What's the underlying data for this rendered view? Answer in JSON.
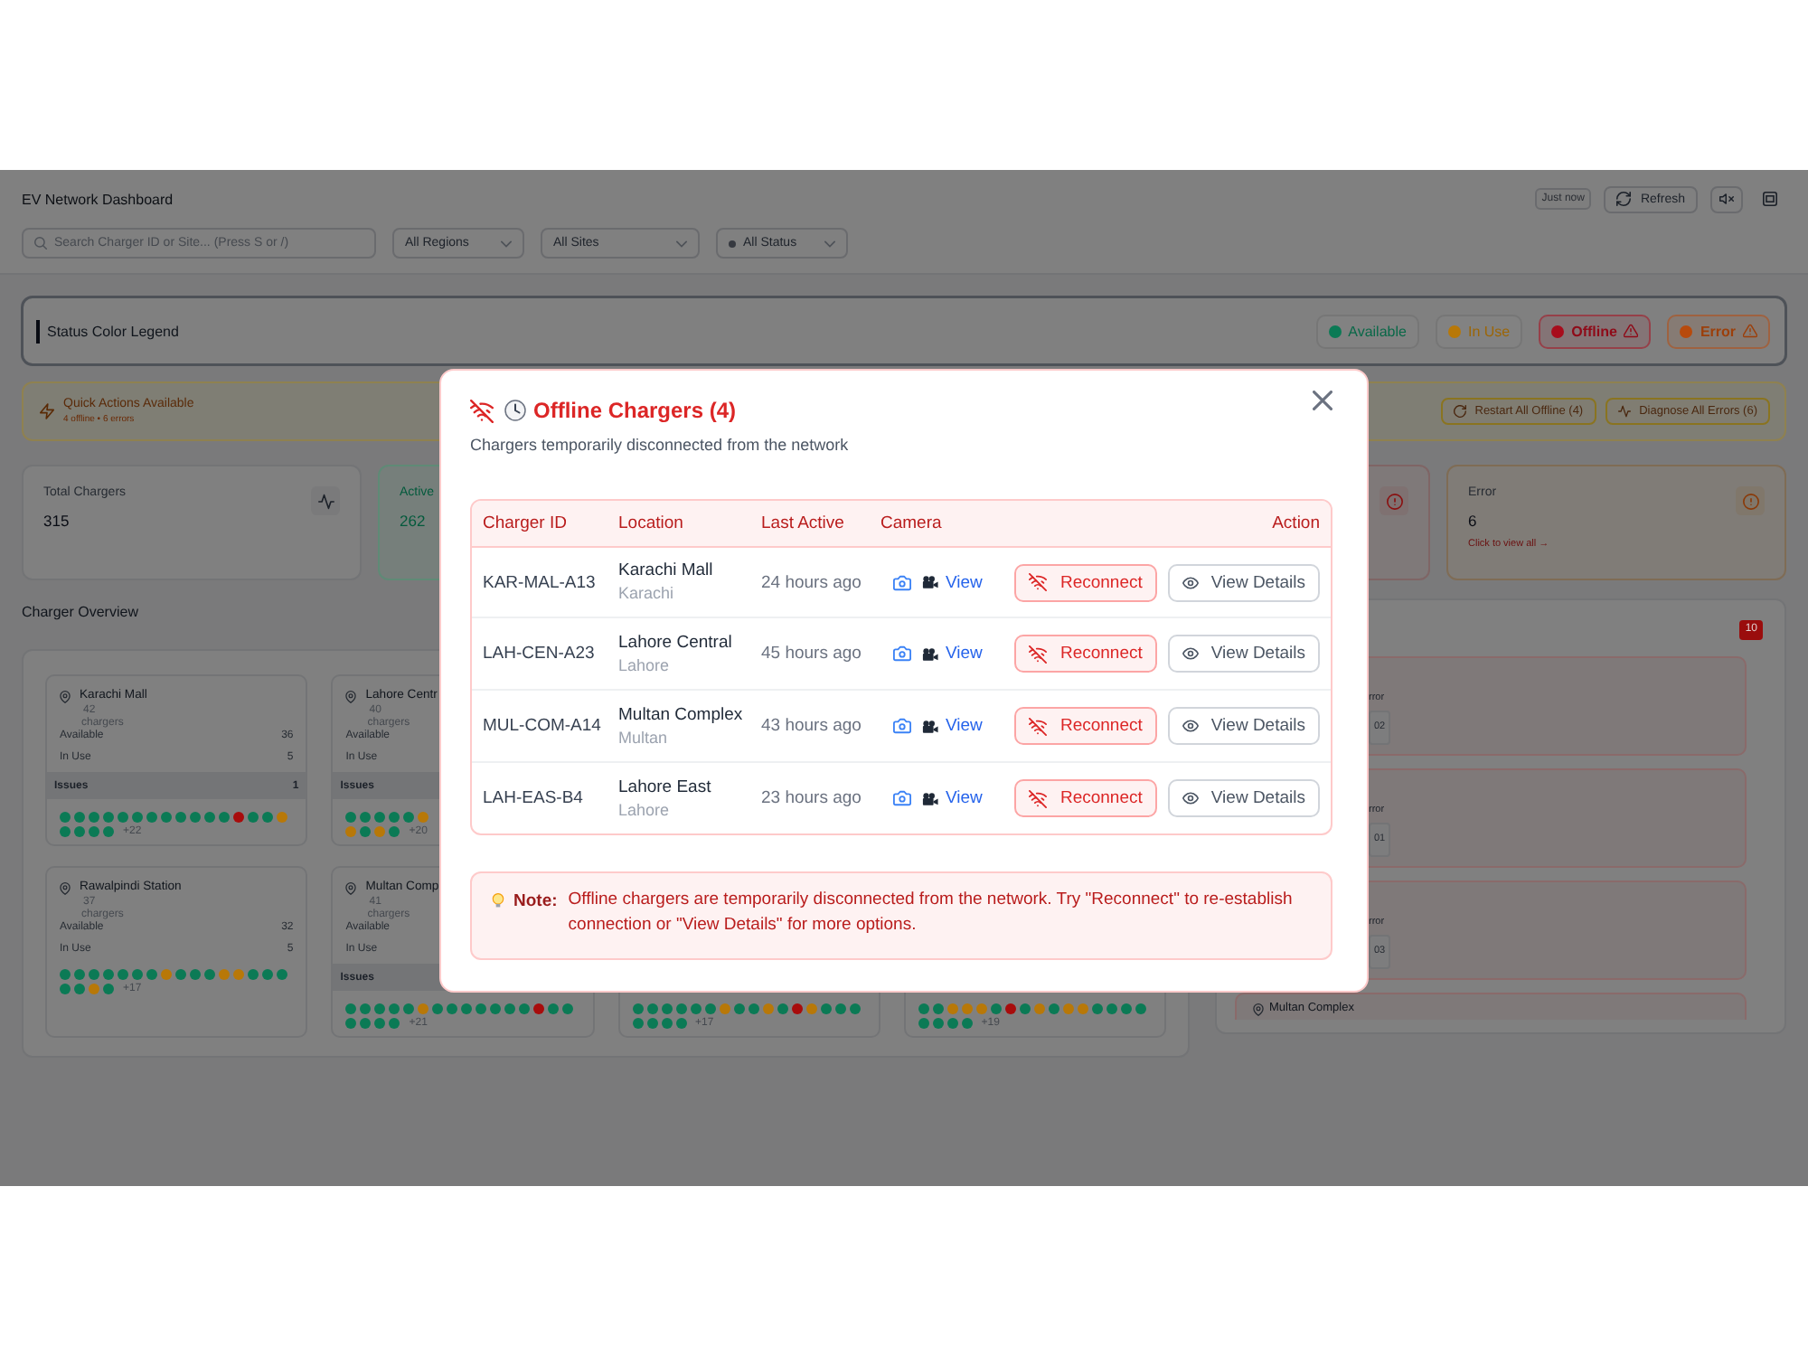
{
  "header": {
    "title": "EV Network Dashboard",
    "updated": "Just now",
    "refresh_label": "Refresh"
  },
  "filters": {
    "search": {
      "placeholder": "Search Charger ID or Site... (Press S or /)"
    },
    "selects": [
      {
        "value": "All Regions",
        "kind": "plain"
      },
      {
        "value": "All Sites",
        "kind": "plain"
      },
      {
        "value": "All Status",
        "kind": "status"
      }
    ]
  },
  "legend": {
    "title": "Status Color Legend",
    "items": [
      {
        "label": "Available",
        "color": "#0b7a55",
        "warning": false
      },
      {
        "label": "In Use",
        "color": "#b87808",
        "warning": false
      },
      {
        "label": "Offline",
        "color": "#a80c1c",
        "warning": true
      },
      {
        "label": "Error",
        "color": "#b84a0c",
        "warning": true
      }
    ]
  },
  "quick_actions": {
    "title": "Quick Actions Available",
    "summary": "4 offline • 6 errors",
    "buttons": [
      {
        "label": "Restart All Offline (4)",
        "kind": "restart"
      },
      {
        "label": "Diagnose All Errors (6)",
        "kind": "diagnose"
      }
    ]
  },
  "stats": [
    {
      "kind": "total",
      "label": "Total Chargers",
      "value": "315"
    },
    {
      "kind": "active",
      "label": "Active",
      "value": "262"
    },
    {
      "kind": "offline"
    },
    {
      "kind": "error",
      "label": "Error",
      "value": "6",
      "link": "Click to view all →"
    }
  ],
  "overview": {
    "title": "Charger Overview",
    "rows": [
      [
        {
          "name": "Karachi Mall",
          "count": "42",
          "unit": "chargers",
          "stats": [
            {
              "label": "Available",
              "value": "36"
            },
            {
              "label": "In Use",
              "value": "5"
            }
          ],
          "issues": {
            "label": "Issues",
            "value": "1"
          },
          "dot_rows": [
            [
              {
                "color": "#0b7a55"
              },
              {
                "color": "#0b7a55"
              },
              {
                "color": "#0b7a55"
              },
              {
                "color": "#0b7a55"
              },
              {
                "color": "#0b7a55"
              },
              {
                "color": "#0b7a55"
              },
              {
                "color": "#0b7a55"
              },
              {
                "color": "#0b7a55"
              },
              {
                "color": "#0b7a55"
              },
              {
                "color": "#0b7a55"
              },
              {
                "color": "#0b7a55"
              },
              {
                "color": "#0b7a55"
              },
              {
                "color": "#a80c0c"
              },
              {
                "color": "#0b7a55"
              },
              {
                "color": "#0b7a55"
              },
              {
                "color": "#b87808"
              }
            ],
            [
              {
                "color": "#0b7a55"
              },
              {
                "color": "#0b7a55"
              },
              {
                "color": "#0b7a55"
              },
              {
                "color": "#0b7a55"
              }
            ]
          ],
          "more": "+22"
        },
        {
          "name": "Lahore Centr",
          "count": "40",
          "unit": "chargers",
          "stats": [
            {
              "label": "Available"
            },
            {
              "label": "In Use"
            }
          ],
          "issues": {
            "label": "Issues"
          },
          "dot_rows": [
            [
              {
                "color": "#0b7a55"
              },
              {
                "color": "#0b7a55"
              },
              {
                "color": "#0b7a55"
              },
              {
                "color": "#0b7a55"
              },
              {
                "color": "#0b7a55"
              },
              {
                "color": "#b87808"
              }
            ],
            [
              {
                "color": "#b87808"
              },
              {
                "color": "#0b7a55"
              },
              {
                "color": "#b87808"
              },
              {
                "color": "#0b7a55"
              }
            ]
          ],
          "more": "+20"
        }
      ],
      [
        {
          "name": "Rawalpindi Station",
          "count": "37",
          "unit": "chargers",
          "stats": [
            {
              "label": "Available",
              "value": "32"
            },
            {
              "label": "In Use",
              "value": "5"
            }
          ],
          "dot_rows": [
            [
              {
                "color": "#0b7a55"
              },
              {
                "color": "#0b7a55"
              },
              {
                "color": "#0b7a55"
              },
              {
                "color": "#0b7a55"
              },
              {
                "color": "#0b7a55"
              },
              {
                "color": "#0b7a55"
              },
              {
                "color": "#0b7a55"
              },
              {
                "color": "#b87808"
              },
              {
                "color": "#0b7a55"
              },
              {
                "color": "#0b7a55"
              },
              {
                "color": "#0b7a55"
              },
              {
                "color": "#b87808"
              },
              {
                "color": "#b87808"
              },
              {
                "color": "#0b7a55"
              },
              {
                "color": "#0b7a55"
              },
              {
                "color": "#0b7a55"
              }
            ],
            [
              {
                "color": "#0b7a55"
              },
              {
                "color": "#0b7a55"
              },
              {
                "color": "#b87808"
              },
              {
                "color": "#0b7a55"
              }
            ]
          ],
          "more": "+17"
        },
        {
          "name": "Multan Comp",
          "count": "41",
          "unit": "chargers",
          "stats": [
            {
              "label": "Available"
            },
            {
              "label": "In Use"
            }
          ],
          "issues": {
            "label": "Issues"
          },
          "dot_rows": [
            [
              {
                "color": "#0b7a55"
              },
              {
                "color": "#0b7a55"
              },
              {
                "color": "#0b7a55"
              },
              {
                "color": "#0b7a55"
              },
              {
                "color": "#0b7a55"
              },
              {
                "color": "#b87808"
              },
              {
                "color": "#0b7a55"
              },
              {
                "color": "#0b7a55"
              },
              {
                "color": "#0b7a55"
              },
              {
                "color": "#0b7a55"
              },
              {
                "color": "#0b7a55"
              },
              {
                "color": "#0b7a55"
              },
              {
                "color": "#0b7a55"
              },
              {
                "color": "#a80c0c"
              },
              {
                "color": "#0b7a55"
              },
              {
                "color": "#0b7a55"
              }
            ],
            [
              {
                "color": "#0b7a55"
              },
              {
                "color": "#0b7a55"
              },
              {
                "color": "#0b7a55"
              },
              {
                "color": "#0b7a55"
              }
            ]
          ],
          "more": "+21"
        },
        {
          "dot_rows": [
            [
              {
                "color": "#0b7a55"
              },
              {
                "color": "#0b7a55"
              },
              {
                "color": "#0b7a55"
              },
              {
                "color": "#0b7a55"
              },
              {
                "color": "#0b7a55"
              },
              {
                "color": "#0b7a55"
              },
              {
                "color": "#b87808"
              },
              {
                "color": "#0b7a55"
              },
              {
                "color": "#0b7a55"
              },
              {
                "color": "#b87808"
              },
              {
                "color": "#0b7a55"
              },
              {
                "color": "#a80c0c"
              },
              {
                "color": "#b87808"
              },
              {
                "color": "#0b7a55"
              },
              {
                "color": "#0b7a55"
              },
              {
                "color": "#0b7a55"
              }
            ],
            [
              {
                "color": "#0b7a55"
              },
              {
                "color": "#0b7a55"
              },
              {
                "color": "#0b7a55"
              },
              {
                "color": "#0b7a55"
              }
            ]
          ],
          "more": "+17"
        },
        {
          "dot_rows": [
            [
              {
                "color": "#0b7a55"
              },
              {
                "color": "#0b7a55"
              },
              {
                "color": "#b87808"
              },
              {
                "color": "#b87808"
              },
              {
                "color": "#b87808"
              },
              {
                "color": "#0b7a55"
              },
              {
                "color": "#a80c0c"
              },
              {
                "color": "#0b7a55"
              },
              {
                "color": "#b87808"
              },
              {
                "color": "#0b7a55"
              },
              {
                "color": "#b87808"
              },
              {
                "color": "#b87808"
              },
              {
                "color": "#0b7a55"
              },
              {
                "color": "#0b7a55"
              },
              {
                "color": "#0b7a55"
              },
              {
                "color": "#0b7a55"
              }
            ],
            [
              {
                "color": "#0b7a55"
              },
              {
                "color": "#0b7a55"
              },
              {
                "color": "#0b7a55"
              },
              {
                "color": "#0b7a55"
              }
            ]
          ],
          "more": "+19"
        }
      ]
    ]
  },
  "alerts": {
    "badge": "10",
    "items": [
      {
        "kind": "error",
        "text": "rror",
        "code": "02"
      },
      {
        "kind": "error",
        "text": "rror",
        "code": "01"
      },
      {
        "kind": "error",
        "text": "rror",
        "code": "03"
      },
      {
        "kind": "site",
        "site": "Multan Complex"
      }
    ]
  },
  "modal": {
    "title": "Offline Chargers (4)",
    "subtitle": "Chargers temporarily disconnected from the network",
    "columns": [
      "Charger ID",
      "Location",
      "Last Active",
      "Camera",
      "Action"
    ],
    "rows": [
      {
        "id": "KAR-MAL-A13",
        "site": "Karachi Mall",
        "city": "Karachi",
        "last_active": "24 hours ago",
        "camera": "View",
        "actions": [
          {
            "label": "Reconnect",
            "kind": "reconnect"
          },
          {
            "label": "View Details",
            "kind": "details"
          }
        ]
      },
      {
        "id": "LAH-CEN-A23",
        "site": "Lahore Central",
        "city": "Lahore",
        "last_active": "45 hours ago",
        "camera": "View",
        "actions": [
          {
            "label": "Reconnect",
            "kind": "reconnect"
          },
          {
            "label": "View Details",
            "kind": "details"
          }
        ]
      },
      {
        "id": "MUL-COM-A14",
        "site": "Multan Complex",
        "city": "Multan",
        "last_active": "43 hours ago",
        "camera": "View",
        "actions": [
          {
            "label": "Reconnect",
            "kind": "reconnect"
          },
          {
            "label": "View Details",
            "kind": "details"
          }
        ]
      },
      {
        "id": "LAH-EAS-B4",
        "site": "Lahore East",
        "city": "Lahore",
        "last_active": "23 hours ago",
        "camera": "View",
        "actions": [
          {
            "label": "Reconnect",
            "kind": "reconnect"
          },
          {
            "label": "View Details",
            "kind": "details"
          }
        ]
      }
    ],
    "note": {
      "label": "Note:",
      "text": "Offline chargers are temporarily disconnected from the network. Try \"Reconnect\" to re-establish connection or \"View Details\" for more options."
    }
  }
}
